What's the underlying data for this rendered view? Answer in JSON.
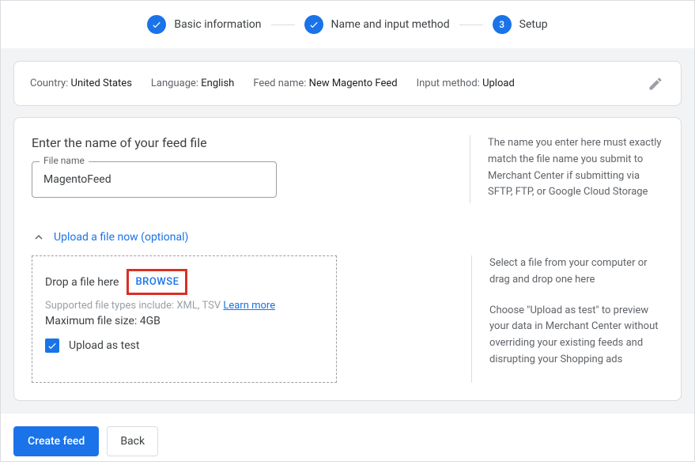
{
  "stepper": {
    "steps": [
      {
        "label": "Basic information",
        "state": "done"
      },
      {
        "label": "Name and input method",
        "state": "done"
      },
      {
        "label": "Setup",
        "state": "active",
        "number": "3"
      }
    ]
  },
  "summary": {
    "country_label": "Country:",
    "country_value": "United States",
    "language_label": "Language:",
    "language_value": "English",
    "feedname_label": "Feed name:",
    "feedname_value": "New Magento Feed",
    "inputmethod_label": "Input method:",
    "inputmethod_value": "Upload"
  },
  "form": {
    "title": "Enter the name of your feed file",
    "filename_label": "File name",
    "filename_value": "MagentoFeed",
    "help_text": "The name you enter here must exactly match the file name you submit to Merchant Center if submitting via SFTP, FTP, or Google Cloud Storage"
  },
  "upload": {
    "toggle_label": "Upload a file now (optional)",
    "drop_label": "Drop a file here",
    "browse_label": "BROWSE",
    "supported_text": "Supported file types include: XML, TSV",
    "learn_more": "Learn more",
    "max_size": "Maximum file size: 4GB",
    "checkbox_label": "Upload as test",
    "help_text_1": "Select a file from your computer or drag and drop one here",
    "help_text_2": "Choose \"Upload as test\" to preview your data in Merchant Center without overriding your existing feeds and disrupting your Shopping ads"
  },
  "footer": {
    "primary": "Create feed",
    "secondary": "Back"
  }
}
